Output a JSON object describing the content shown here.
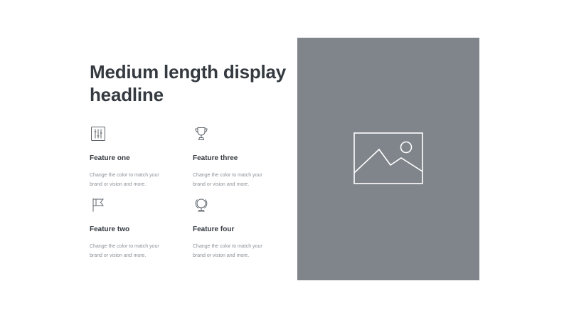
{
  "headline": "Medium length display headline",
  "features": [
    {
      "title": "Feature one",
      "description": "Change the color to match your brand or vision and more.",
      "icon": "sliders-icon"
    },
    {
      "title": "Feature three",
      "description": "Change the color to match your brand or vision and more.",
      "icon": "trophy-icon"
    },
    {
      "title": "Feature two",
      "description": "Change the color to match your brand or vision and more.",
      "icon": "flag-icon"
    },
    {
      "title": "Feature four",
      "description": "Change the color to match your brand or vision and more.",
      "icon": "globe-icon"
    }
  ],
  "image_panel": {
    "icon": "image-placeholder-icon",
    "background_color": "#80858b"
  },
  "colors": {
    "heading": "#343a40",
    "body_text": "#8a9096",
    "icon_stroke": "#5c636a"
  }
}
